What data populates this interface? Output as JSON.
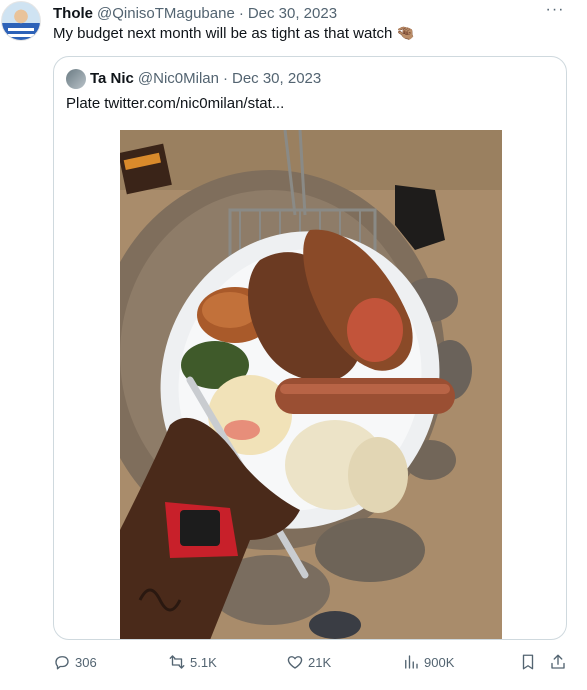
{
  "tweet": {
    "author_name": "Thole",
    "author_handle": "@QinisoTMagubane",
    "separator": "·",
    "date": "Dec 30, 2023",
    "text": "My budget next month will be as tight as that watch",
    "emoji": "🤏🏽"
  },
  "quoted": {
    "author_name": "Ta Nic",
    "author_handle": "@Nic0Milan",
    "separator": "·",
    "date": "Dec 30, 2023",
    "text": "Plate",
    "link": "twitter.com/nic0milan/stat..."
  },
  "actions": {
    "replies": "306",
    "reposts": "5.1K",
    "likes": "21K",
    "views": "900K"
  },
  "icons": {
    "more": "more-icon",
    "reply": "reply-icon",
    "repost": "repost-icon",
    "like": "heart-icon",
    "views": "views-icon",
    "bookmark": "bookmark-icon",
    "share": "share-icon"
  },
  "colors": {
    "text_primary": "#0f1419",
    "text_secondary": "#536471",
    "border": "#cfd9de"
  }
}
